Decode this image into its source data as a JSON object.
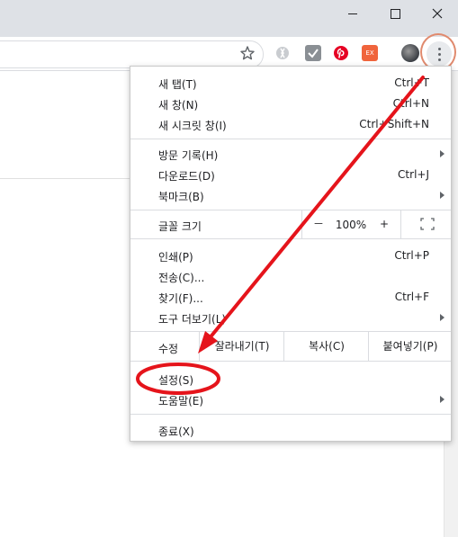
{
  "window": {
    "minimize_icon": "minimize-icon",
    "maximize_icon": "maximize-icon",
    "close_icon": "close-icon"
  },
  "toolbar": {
    "extensions": [
      {
        "name": "extension-gray-s",
        "icon": "s-logo-icon"
      },
      {
        "name": "extension-check",
        "icon": "check-icon"
      },
      {
        "name": "extension-pinterest",
        "icon": "pinterest-icon"
      },
      {
        "name": "extension-ex",
        "icon": "ex-badge-icon",
        "label": "EX"
      }
    ],
    "bookmark_icon": "star-icon",
    "menu_icon": "three-dots-icon"
  },
  "menu": {
    "new_tab": {
      "label": "새 탭(T)",
      "shortcut": "Ctrl+T"
    },
    "new_window": {
      "label": "새 창(N)",
      "shortcut": "Ctrl+N"
    },
    "incognito": {
      "label": "새 시크릿 창(I)",
      "shortcut": "Ctrl+Shift+N"
    },
    "history": {
      "label": "방문 기록(H)"
    },
    "downloads": {
      "label": "다운로드(D)",
      "shortcut": "Ctrl+J"
    },
    "bookmarks": {
      "label": "북마크(B)"
    },
    "zoom": {
      "label": "글꼴 크기",
      "minus": "－",
      "value": "100%",
      "plus": "+"
    },
    "print": {
      "label": "인쇄(P)",
      "shortcut": "Ctrl+P"
    },
    "cast": {
      "label": "전송(C)..."
    },
    "find": {
      "label": "찾기(F)...",
      "shortcut": "Ctrl+F"
    },
    "more_tools": {
      "label": "도구 더보기(L)"
    },
    "edit": {
      "label": "수정",
      "cut": "잘라내기(T)",
      "copy": "복사(C)",
      "paste": "붙여넣기(P)"
    },
    "settings": {
      "label": "설정(S)"
    },
    "help": {
      "label": "도움말(E)"
    },
    "exit": {
      "label": "종료(X)"
    }
  },
  "annotation": {
    "color": "#e5141b",
    "circle_color": "#e08a6e"
  }
}
